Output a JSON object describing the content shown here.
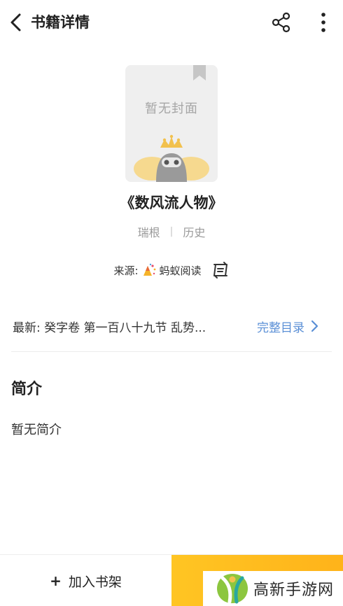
{
  "header": {
    "title": "书籍详情",
    "back_icon": "back-arrow-icon",
    "share_icon": "share-icon",
    "more_icon": "more-vertical-icon"
  },
  "book": {
    "cover_placeholder": "暂无封面",
    "name": "《数风流人物》",
    "author": "瑞根",
    "separator": "|",
    "category": "历史"
  },
  "source": {
    "label": "来源:",
    "name": "蚂蚁阅读"
  },
  "latest": {
    "text": "最新: 癸字卷 第一百八十九节 乱势...",
    "catalog_label": "完整目录"
  },
  "intro": {
    "title": "简介",
    "body": "暂无简介"
  },
  "bottom": {
    "add_shelf_icon": "+",
    "add_shelf_label": "加入书架"
  },
  "watermark": {
    "text": "高新手游网"
  },
  "colors": {
    "accent_link": "#5a8fd6",
    "read_button": "#ffc523",
    "cover_bg": "#efefef"
  }
}
